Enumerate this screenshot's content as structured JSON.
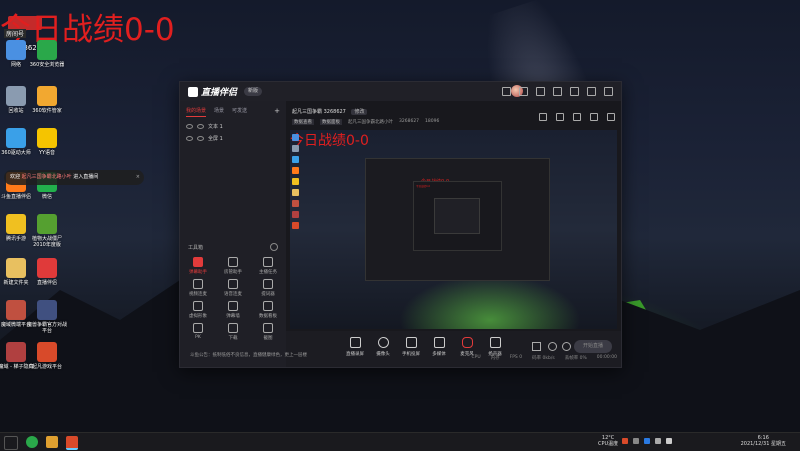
{
  "overlay": {
    "text": "今日战绩0-0",
    "badge_top": "LED",
    "badge_bottom": "房间号",
    "room_number": "3268627"
  },
  "desktop_icons": [
    {
      "label": "网络",
      "color": "#4a90e2"
    },
    {
      "label": "360安全浏览器",
      "color": "#2aa84a"
    },
    {
      "label": "回收站",
      "color": "#8a9bb0"
    },
    {
      "label": "360软件管家",
      "color": "#f2a830"
    },
    {
      "label": "360驱动大师",
      "color": "#3aa0e8"
    },
    {
      "label": "YY语音",
      "color": "#f5c400"
    },
    {
      "label": "斗鱼直播伴侣",
      "color": "#ff7a1a"
    },
    {
      "label": "微信",
      "color": "#22b14c"
    },
    {
      "label": "腾讯手游",
      "color": "#f0c020"
    },
    {
      "label": "植物大战僵尸2010年度版",
      "color": "#55a030"
    },
    {
      "label": "新建文件夹",
      "color": "#e8c060"
    },
    {
      "label": "直播伴侣",
      "color": "#e03a3a"
    },
    {
      "label": "魔域微端平台",
      "color": "#c05040"
    },
    {
      "label": "魔兽争霸官方对战平台",
      "color": "#405080"
    },
    {
      "label": "魔域 - 梯子隐藏",
      "color": "#b04040"
    },
    {
      "label": "起凡游戏平台",
      "color": "#d84a2a"
    }
  ],
  "toast": {
    "prefix": "欢迎",
    "highlight": "起凡三国争霸北路小叶",
    "suffix": "进入直播间"
  },
  "app": {
    "logo": "直播伴侣",
    "version_badge": "新版",
    "source_tabs": [
      "我的场景",
      "场景",
      "可发送"
    ],
    "sources": [
      "文本 1",
      "全屏 1"
    ],
    "tools_title": "工具箱",
    "tools": [
      {
        "label": "弹幕助手",
        "active": true
      },
      {
        "label": "房管助手",
        "active": false
      },
      {
        "label": "主播任务",
        "active": false
      },
      {
        "label": "视频连麦",
        "active": false
      },
      {
        "label": "语音连麦",
        "active": false
      },
      {
        "label": "提词器",
        "active": false
      },
      {
        "label": "虚拟形象",
        "active": false
      },
      {
        "label": "弹幕墙",
        "active": false
      },
      {
        "label": "数据看板",
        "active": false
      },
      {
        "label": "PK",
        "active": false
      },
      {
        "label": "下载",
        "active": false
      },
      {
        "label": "截图",
        "active": false
      }
    ],
    "room_title": "起凡三国争霸 3268627",
    "room_modify": "修改",
    "room_tags": [
      "数据查看",
      "数据面板",
      "起凡三国争霸北路小叶",
      "3268627",
      "18096"
    ],
    "preview_overlay": "今日战绩0-0",
    "bottom_actions": [
      "直播录屏",
      "摄像头",
      "手机投屏",
      "多媒体",
      "麦克风",
      "扬声器"
    ],
    "start_button": "开始直播",
    "status_tip": "斗鱼公告：抵制低俗不良信息，直播健康绿色，更上一层楼",
    "status_stats": [
      "CPU",
      "内存",
      "FPS 0",
      "码率 0kb/s",
      "丢帧率 0%",
      "00:00:00"
    ]
  },
  "taskbar": {
    "temp": "12°C",
    "cpu": "CPU温度",
    "time": "6:16",
    "date": "2021/12/31 星期五"
  }
}
